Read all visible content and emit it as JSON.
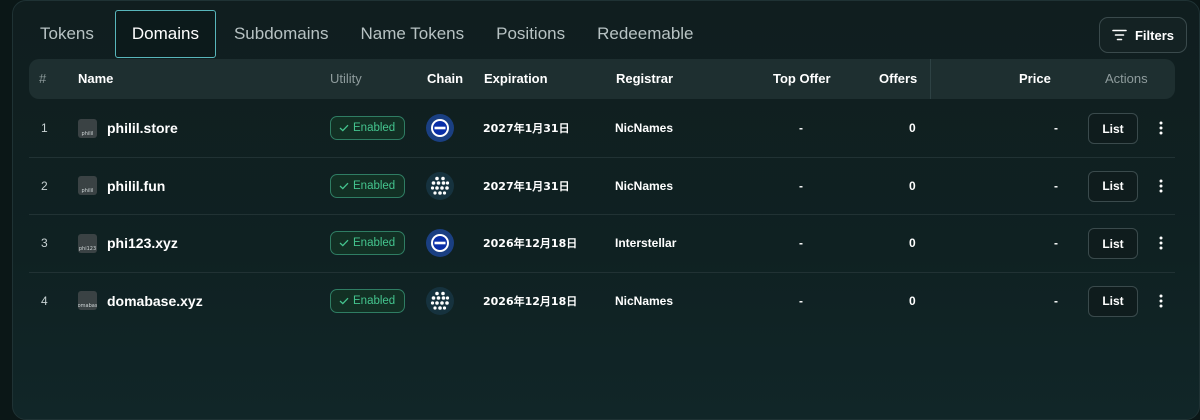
{
  "tabs": [
    {
      "label": "Tokens",
      "active": false
    },
    {
      "label": "Domains",
      "active": true
    },
    {
      "label": "Subdomains",
      "active": false
    },
    {
      "label": "Name Tokens",
      "active": false
    },
    {
      "label": "Positions",
      "active": false
    },
    {
      "label": "Redeemable",
      "active": false
    }
  ],
  "filters_label": "Filters",
  "columns": {
    "index": "#",
    "name": "Name",
    "utility": "Utility",
    "chain": "Chain",
    "expiration": "Expiration",
    "registrar": "Registrar",
    "top_offer": "Top Offer",
    "offers": "Offers",
    "price": "Price",
    "actions": "Actions"
  },
  "rows": [
    {
      "index": "1",
      "favicon_text": "philil",
      "name": "philil.store",
      "utility": "Enabled",
      "chain_icon": "base-icon",
      "expiration": "2027年1月31日",
      "registrar": "NicNames",
      "top_offer": "-",
      "offers": "0",
      "price": "-",
      "action": "List"
    },
    {
      "index": "2",
      "favicon_text": "philil",
      "name": "philil.fun",
      "utility": "Enabled",
      "chain_icon": "mesh-chain-icon",
      "expiration": "2027年1月31日",
      "registrar": "NicNames",
      "top_offer": "-",
      "offers": "0",
      "price": "-",
      "action": "List"
    },
    {
      "index": "3",
      "favicon_text": "phi123",
      "name": "phi123.xyz",
      "utility": "Enabled",
      "chain_icon": "base-icon",
      "expiration": "2026年12月18日",
      "registrar": "Interstellar",
      "top_offer": "-",
      "offers": "0",
      "price": "-",
      "action": "List"
    },
    {
      "index": "4",
      "favicon_text": "domabase",
      "name": "domabase.xyz",
      "utility": "Enabled",
      "chain_icon": "mesh-chain-icon",
      "expiration": "2026年12月18日",
      "registrar": "NicNames",
      "top_offer": "-",
      "offers": "0",
      "price": "-",
      "action": "List"
    }
  ],
  "colors": {
    "accent": "#58b6bb",
    "enabled_green": "#44c48e",
    "background": "#0f2122"
  }
}
